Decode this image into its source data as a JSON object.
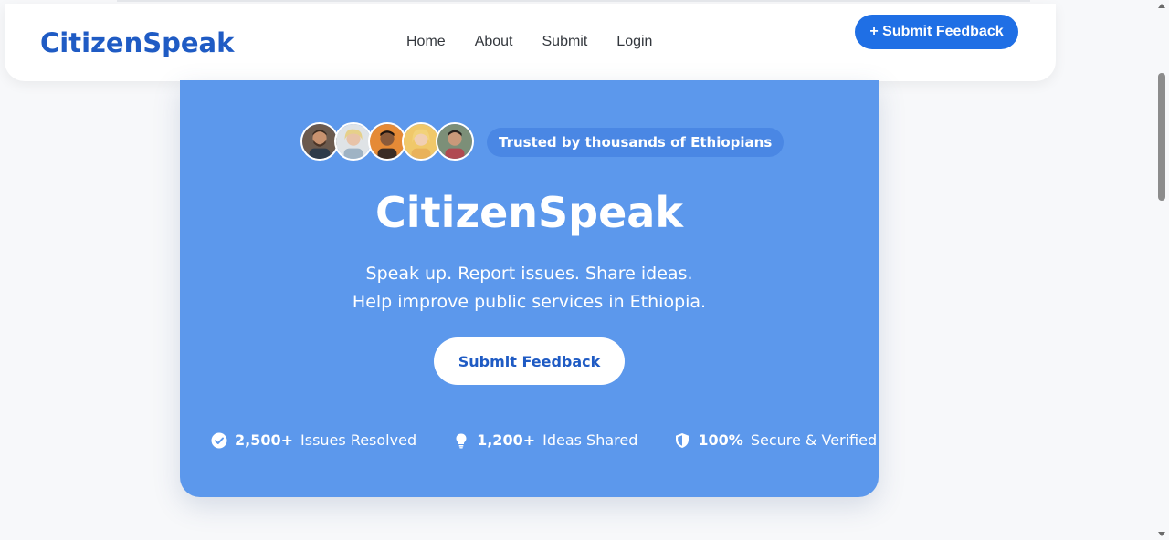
{
  "header": {
    "brand": "CitizenSpeak",
    "nav": [
      "Home",
      "About",
      "Submit",
      "Login"
    ],
    "cta_label": "+ Submit Feedback"
  },
  "hero": {
    "trust_badge": "Trusted by thousands of Ethiopians",
    "title": "CitizenSpeak",
    "subtitle_line1": "Speak up. Report issues. Share ideas.",
    "subtitle_line2": "Help improve public services in Ethiopia.",
    "button_label": "Submit Feedback",
    "avatars": [
      "avatar-1",
      "avatar-2",
      "avatar-3",
      "avatar-4",
      "avatar-5"
    ],
    "stats": [
      {
        "icon": "check-circle-icon",
        "value": "2,500+",
        "label": "Issues Resolved"
      },
      {
        "icon": "lightbulb-icon",
        "value": "1,200+",
        "label": "Ideas Shared"
      },
      {
        "icon": "shield-icon",
        "value": "100%",
        "label": "Secure & Verified"
      }
    ]
  },
  "colors": {
    "brand": "#1f5bc4",
    "cta": "#1f6fe5",
    "hero_bg": "#5c98ec",
    "page_bg": "#f7f8fa"
  }
}
